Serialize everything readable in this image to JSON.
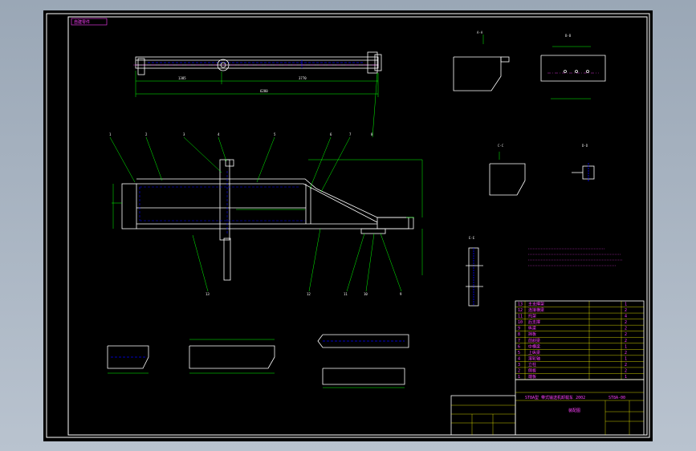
{
  "viewport": {
    "background": "#000000",
    "stage_color": "#a8b3c0"
  },
  "colors": {
    "frame": "#ffffff",
    "outline": "#ffffff",
    "dim": "#00ff00",
    "hidden": "#0000ff",
    "text": "#ff40ff",
    "table": "#ffff00"
  },
  "title_block": {
    "drawing_title": "ST8A型   带式输送机卸载车 2002",
    "drawing_no": "ST8A-00",
    "material_note": "装配图",
    "tag": "自建零件"
  },
  "callouts": [
    "1",
    "2",
    "3",
    "4",
    "5",
    "6",
    "7",
    "8",
    "9",
    "10",
    "11",
    "12",
    "13"
  ],
  "top_dimensions": {
    "overall": "6280",
    "segment_a": "1385",
    "segment_b": "3770"
  },
  "bom_rows": [
    {
      "no": "13",
      "name": "主支撑架",
      "qty": "1"
    },
    {
      "no": "12",
      "name": "连接横梁",
      "qty": "2"
    },
    {
      "no": "11",
      "name": "托架",
      "qty": "4"
    },
    {
      "no": "10",
      "name": "后支撑",
      "qty": "2"
    },
    {
      "no": "9",
      "name": "纵梁",
      "qty": "2"
    },
    {
      "no": "8",
      "name": "挡板",
      "qty": "2"
    },
    {
      "no": "7",
      "name": "前斜梁",
      "qty": "2"
    },
    {
      "no": "6",
      "name": "中横梁",
      "qty": "1"
    },
    {
      "no": "5",
      "name": "上纵梁",
      "qty": "2"
    },
    {
      "no": "4",
      "name": "滚轮轴",
      "qty": "1"
    },
    {
      "no": "3",
      "name": "立柱",
      "qty": "2"
    },
    {
      "no": "2",
      "name": "侧板",
      "qty": "2"
    },
    {
      "no": "1",
      "name": "端板",
      "qty": "1"
    }
  ],
  "section_labels": [
    "A-A",
    "B-B",
    "C-C",
    "D-D",
    "E-E"
  ]
}
